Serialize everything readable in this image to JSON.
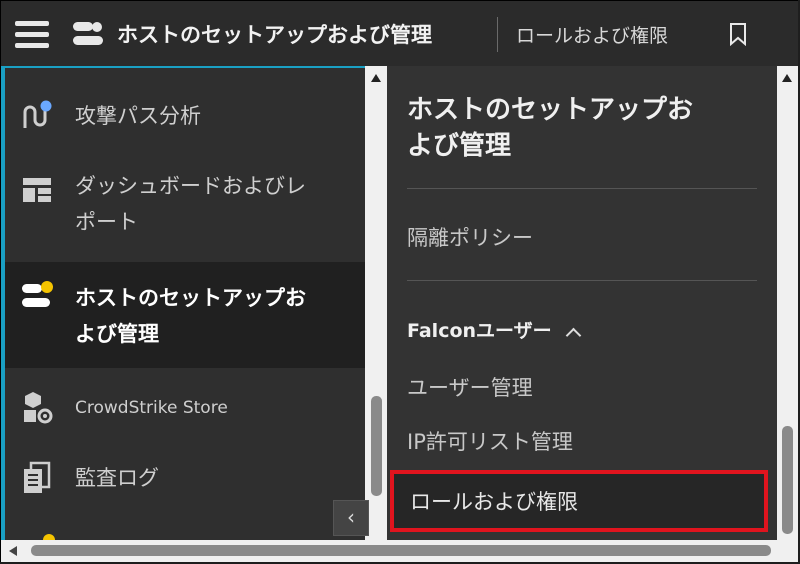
{
  "header": {
    "title": "ホストのセットアップおよび管理",
    "subtitle": "ロールおよび権限",
    "icons": [
      "hamburger-icon",
      "host-setup-icon",
      "bookmark-icon"
    ]
  },
  "sidebar": {
    "items": [
      {
        "label": "攻撃パス分析",
        "icon": "attack-path-icon"
      },
      {
        "label_line1": "ダッシュボードおよびレ",
        "label_line2": "ポート",
        "icon": "dashboard-icon"
      },
      {
        "label_line1": "ホストのセットアップお",
        "label_line2": "よび管理",
        "icon": "host-setup-icon",
        "active": true
      },
      {
        "label": "CrowdStrike Store",
        "icon": "store-icon"
      },
      {
        "label": "監査ログ",
        "icon": "audit-log-icon"
      }
    ],
    "collapse_label": "‹"
  },
  "panel": {
    "title_line1": "ホストのセットアップお",
    "title_line2": "よび管理",
    "links": [
      "隔離ポリシー"
    ],
    "group": {
      "label": "Falconユーザー",
      "expanded": true,
      "items": [
        "ユーザー管理",
        "IP許可リスト管理",
        "ロールおよび権限"
      ],
      "selected": "ロールおよび権限"
    }
  },
  "colors": {
    "accent": "#1aa0c4",
    "highlight_border": "#e0141e",
    "badge": "#f5c400",
    "badge_blue": "#6aa8ff"
  }
}
